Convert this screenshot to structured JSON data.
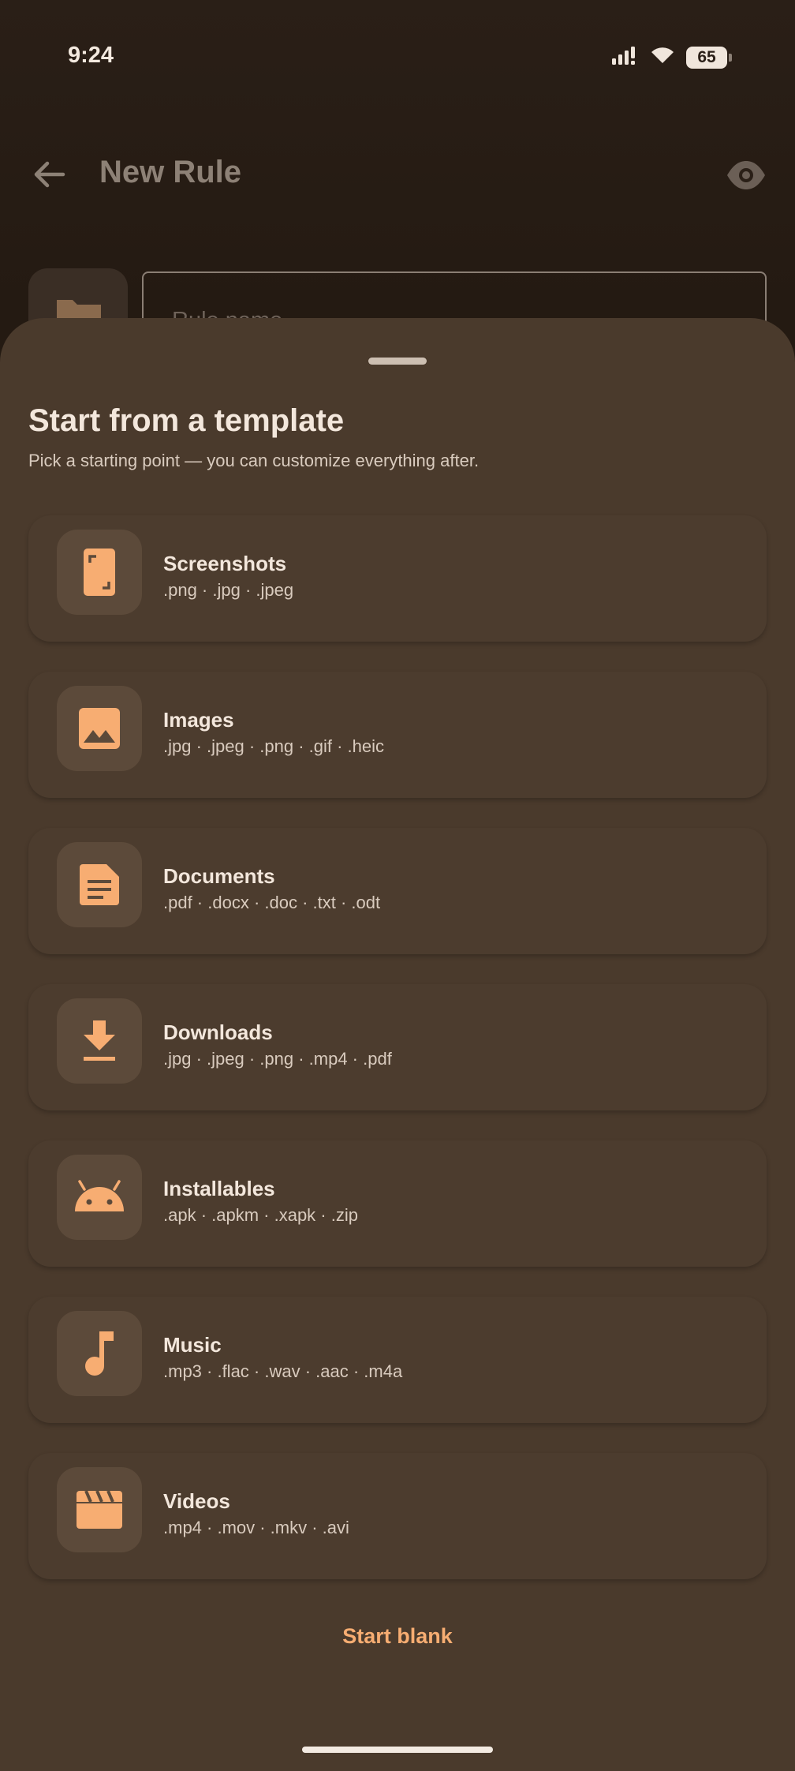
{
  "status_bar": {
    "time": "9:24",
    "battery": "65"
  },
  "app_bar": {
    "title": "New Rule"
  },
  "form": {
    "rule_name_placeholder": "Rule name"
  },
  "sheet": {
    "title": "Start from a template",
    "subtitle": "Pick a starting point — you can customize everything after.",
    "templates": [
      {
        "name": "Screenshots",
        "extensions": ".png · .jpg · .jpeg",
        "icon": "screenshot-icon"
      },
      {
        "name": "Images",
        "extensions": ".jpg · .jpeg · .png · .gif · .heic",
        "icon": "image-icon"
      },
      {
        "name": "Documents",
        "extensions": ".pdf · .docx · .doc · .txt · .odt",
        "icon": "document-icon"
      },
      {
        "name": "Downloads",
        "extensions": ".jpg · .jpeg · .png · .mp4 · .pdf",
        "icon": "download-icon"
      },
      {
        "name": "Installables",
        "extensions": ".apk · .apkm · .xapk · .zip",
        "icon": "android-icon"
      },
      {
        "name": "Music",
        "extensions": ".mp3 · .flac · .wav · .aac · .m4a",
        "icon": "music-note-icon"
      },
      {
        "name": "Videos",
        "extensions": ".mp4 · .mov · .mkv · .avi",
        "icon": "clapperboard-icon"
      }
    ],
    "start_blank_label": "Start blank"
  },
  "colors": {
    "accent": "#f7ad72",
    "sheet_background": "#4a3a2c",
    "icon_box": "#5c4a3a"
  }
}
